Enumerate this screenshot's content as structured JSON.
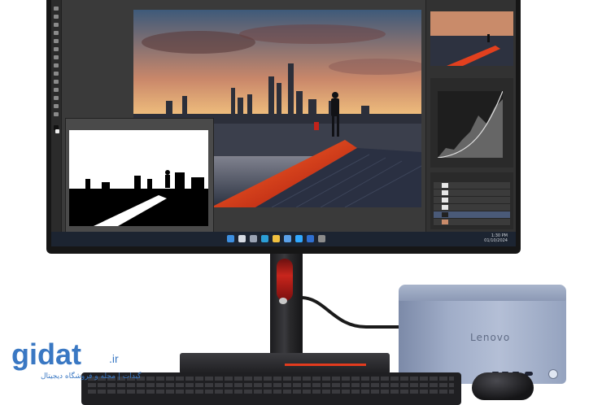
{
  "scene": "monitor-with-mini-pc",
  "screen": {
    "app": "photo-editor",
    "tray_time": "1:30 PM",
    "tray_date": "01/10/2024",
    "layer_names": [
      "Layer",
      "Layer",
      "Layer",
      "Layer",
      "Layer",
      "Layer"
    ]
  },
  "minipc": {
    "logo": "Lenovo"
  },
  "watermark": {
    "logo": "gidat",
    "suffix": ".ir",
    "tagline": "گیدات | مجله و فروشگاه دیجیتال"
  },
  "colors": {
    "accent_red": "#e23b1e",
    "watermark_blue": "#3a78c3",
    "minipc_body": "#a0adc8",
    "taskbar": "#1c2431"
  },
  "icons": [
    "windows-start-icon",
    "search-icon",
    "taskview-icon",
    "edge-icon",
    "folder-icon",
    "store-icon",
    "photoshop-icon",
    "mail-icon",
    "settings-icon"
  ]
}
